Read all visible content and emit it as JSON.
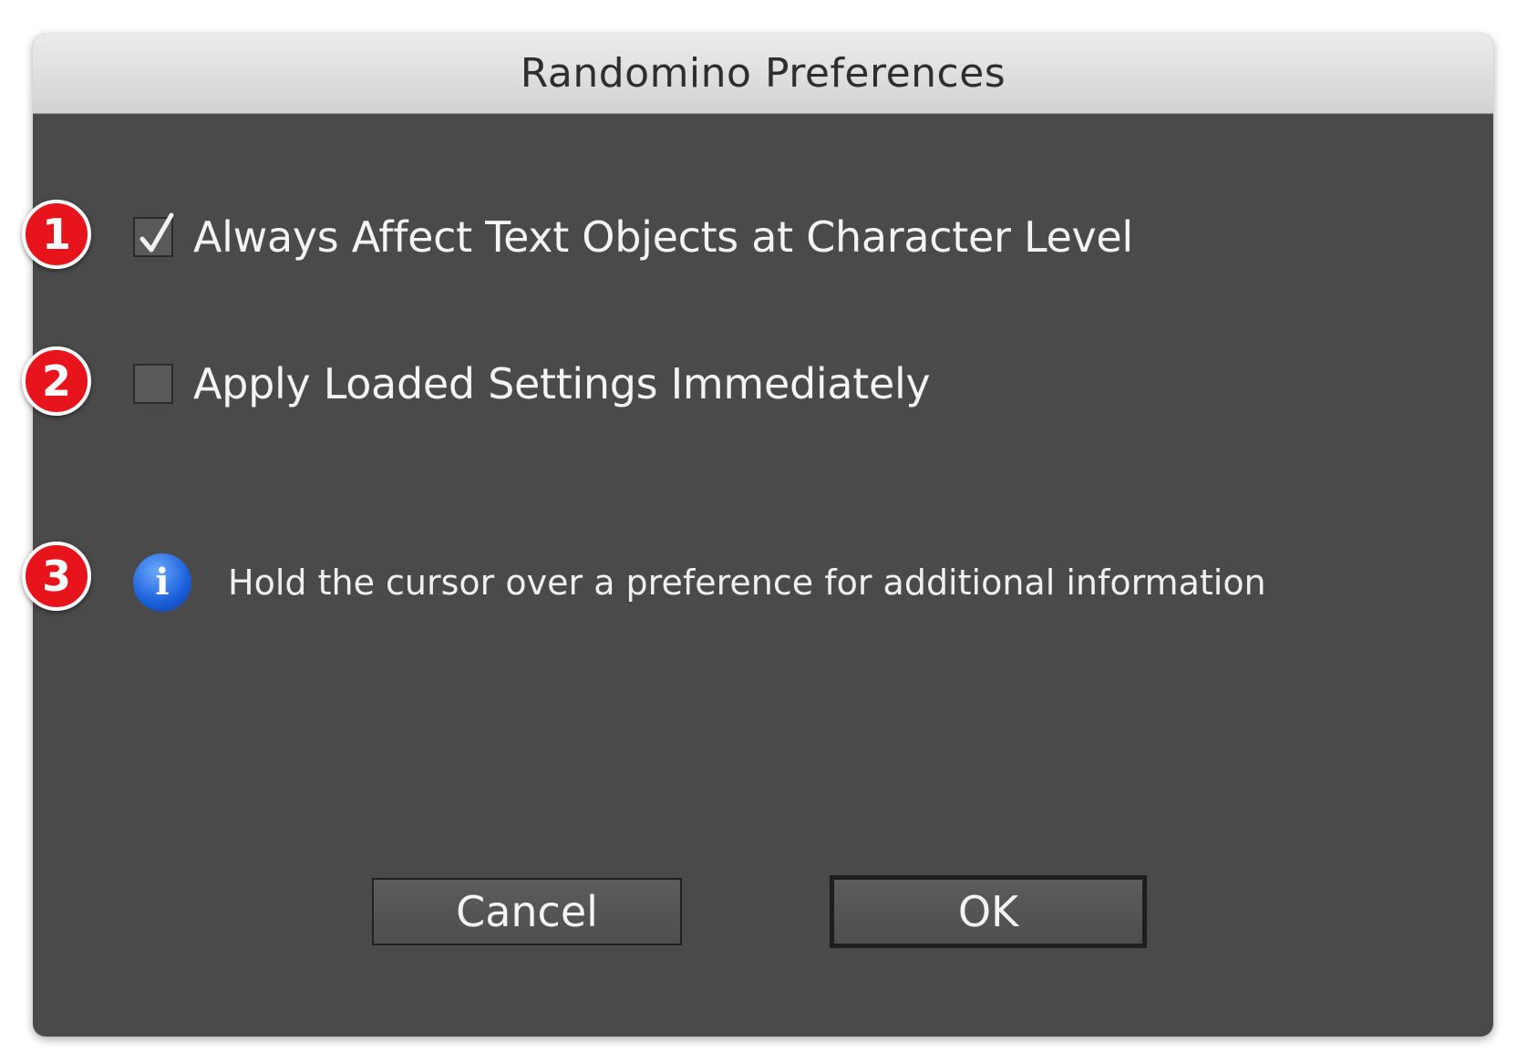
{
  "window": {
    "title": "Randomino Preferences"
  },
  "options": [
    {
      "label": "Always Affect Text Objects at Character Level",
      "checked": true
    },
    {
      "label": "Apply Loaded Settings Immediately",
      "checked": false
    }
  ],
  "info": {
    "icon": "info-icon",
    "glyph": "i",
    "text": "Hold the cursor over a preference for additional information"
  },
  "buttons": {
    "cancel_label": "Cancel",
    "ok_label": "OK"
  },
  "callouts": [
    "1",
    "2",
    "3"
  ],
  "colors": {
    "dialog_bg": "#4a4a4a",
    "callout": "#e8141b",
    "info_blue": "#1b5fd9"
  }
}
